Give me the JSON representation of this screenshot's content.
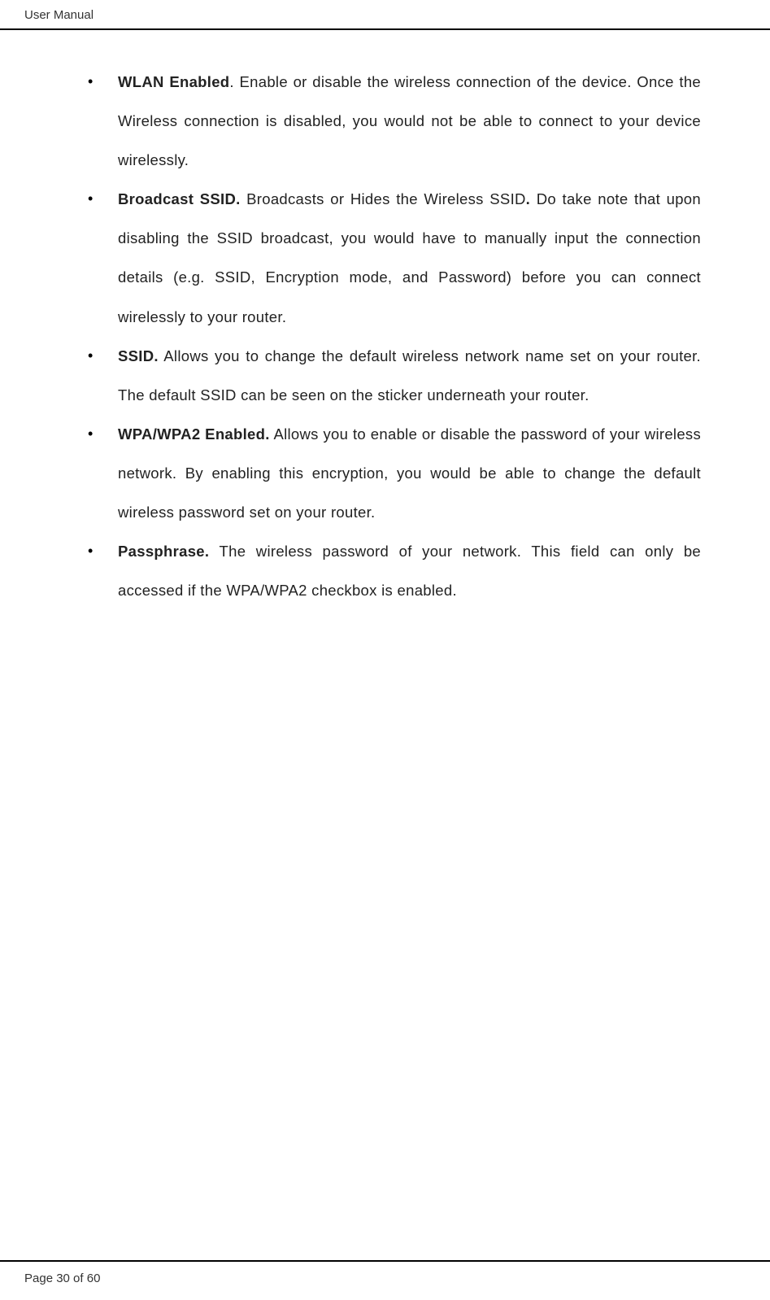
{
  "header": {
    "title": "User Manual"
  },
  "content": {
    "items": [
      {
        "term": "WLAN Enabled",
        "punctuation": ". ",
        "description": "Enable or disable the wireless connection of the device. Once the Wireless connection is disabled, you would not be able to connect to your device wirelessly."
      },
      {
        "term": "Broadcast SSID.",
        "punctuation": " ",
        "description_part1": "Broadcasts or Hides the Wireless SSID",
        "bold_period": ".",
        "description_part2": " Do take note that upon disabling the SSID broadcast, you would have to manually input the connection details (e.g. SSID, Encryption mode, and Password) before you can connect wirelessly to your router."
      },
      {
        "term": "SSID.",
        "punctuation": " ",
        "description": "Allows you to change the default wireless network name set on your router. The default SSID can be seen on the sticker underneath your router."
      },
      {
        "term": "WPA/WPA2 Enabled.",
        "punctuation": " ",
        "description": "Allows you to enable or disable the password of your wireless network. By enabling this encryption, you would be able to change the default wireless password set on your router."
      },
      {
        "term": "Passphrase.",
        "punctuation": " ",
        "description": "The wireless password of your network. This field can only be accessed if the WPA/WPA2 checkbox is enabled."
      }
    ]
  },
  "footer": {
    "page_text": "Page 30 of 60"
  }
}
